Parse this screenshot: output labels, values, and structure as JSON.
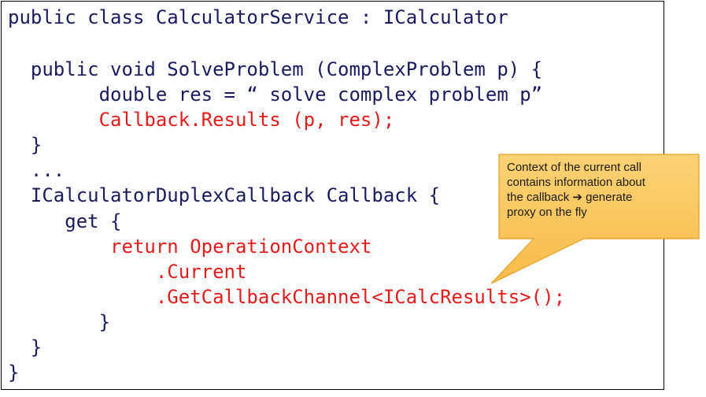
{
  "code": {
    "lines": [
      {
        "text": "public class CalculatorService : ICalculator",
        "color": "#1a1a5e"
      },
      {
        "text": "",
        "color": "#1a1a5e"
      },
      {
        "text": "  public void SolveProblem (ComplexProblem p) {",
        "color": "#1a1a5e"
      },
      {
        "text": "        double res = “ solve complex problem p”",
        "color": "#1a1a5e"
      },
      {
        "text": "        Callback.Results (p, res);",
        "color": "#e31b1b"
      },
      {
        "text": "  }",
        "color": "#1a1a5e"
      },
      {
        "text": "  ...",
        "color": "#1a1a5e"
      },
      {
        "text": "  ICalculatorDuplexCallback Callback {",
        "color": "#1a1a5e"
      },
      {
        "text": "     get {",
        "color": "#1a1a5e"
      },
      {
        "text": "         return OperationContext",
        "color": "#e31b1b"
      },
      {
        "text": "             .Current",
        "color": "#e31b1b"
      },
      {
        "text": "             .GetCallbackChannel<ICalcResults>();",
        "color": "#e31b1b"
      },
      {
        "text": "        }",
        "color": "#1a1a5e"
      },
      {
        "text": "  }",
        "color": "#1a1a5e"
      },
      {
        "text": "}",
        "color": "#1a1a5e"
      }
    ]
  },
  "callout": {
    "text": "Context of the current call\ncontains information about\nthe callback ➔ generate\nproxy on the fly",
    "fill": "#f9c55a",
    "border": "#e8a020"
  }
}
